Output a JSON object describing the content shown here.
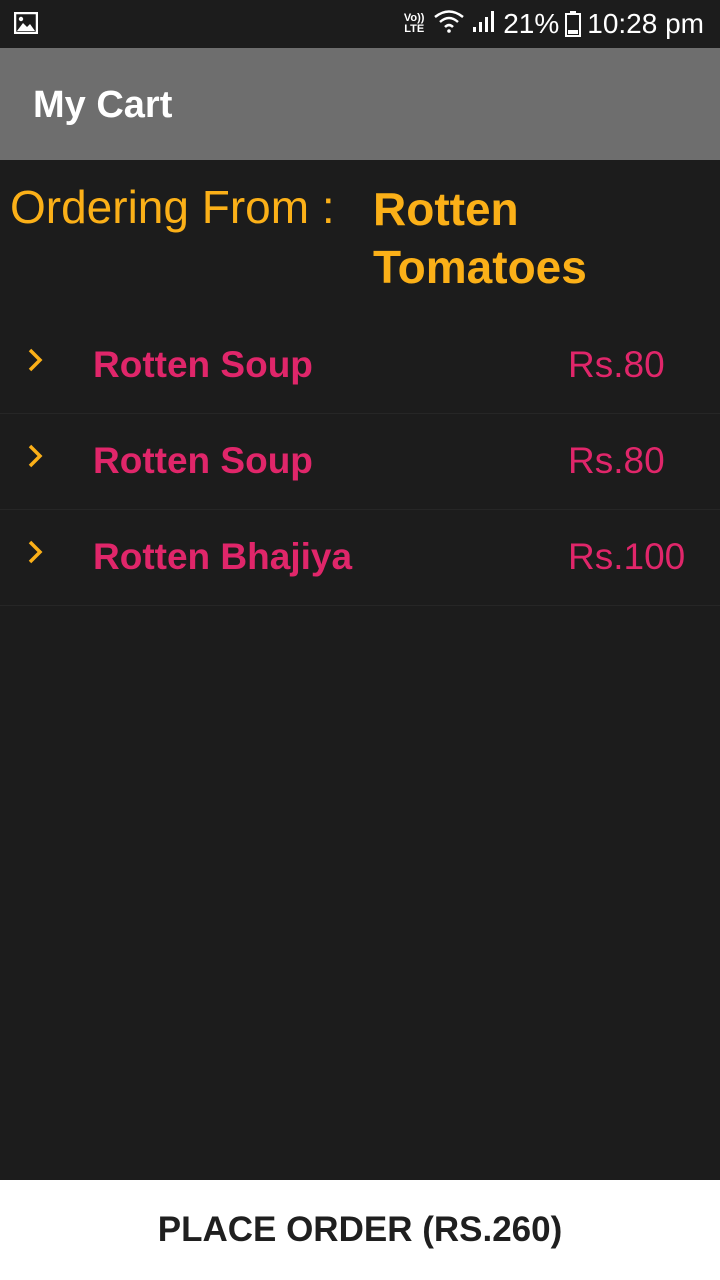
{
  "status_bar": {
    "left_icon": "image-icon",
    "network_label": "Vo)) LTE",
    "battery_percent": "21%",
    "time": "10:28 pm"
  },
  "app_bar": {
    "title": "My Cart"
  },
  "ordering": {
    "label": "Ordering From :",
    "restaurant": "Rotten Tomatoes"
  },
  "cart": {
    "items": [
      {
        "name": "Rotten Soup",
        "price": "Rs.80",
        "icon": "chevron-right-icon"
      },
      {
        "name": "Rotten Soup",
        "price": "Rs.80",
        "icon": "chevron-right-icon"
      },
      {
        "name": "Rotten Bhajiya",
        "price": "Rs.100",
        "icon": "chevron-right-icon"
      }
    ]
  },
  "place_order": {
    "label": "PLACE ORDER (RS.260)"
  },
  "colors": {
    "background": "#1c1c1c",
    "app_bar": "#6e6e6e",
    "accent_orange": "#fbb018",
    "accent_pink": "#e0266a",
    "button_bg": "#ffffff"
  }
}
